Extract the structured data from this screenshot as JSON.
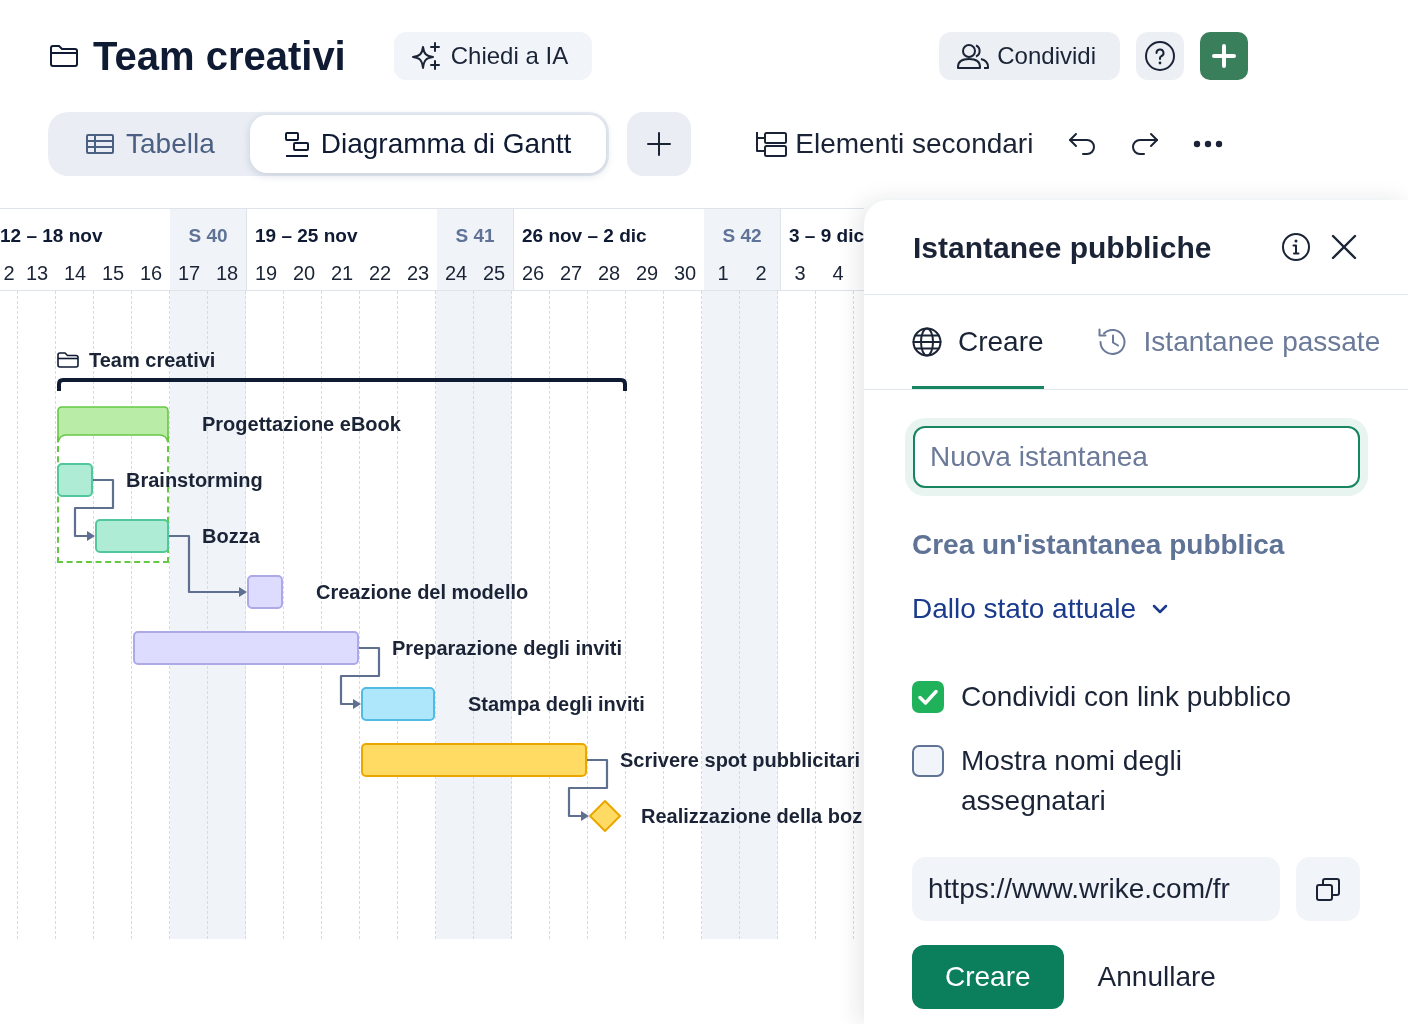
{
  "header": {
    "title": "Team creativi",
    "ai_button": "Chiedi a IA",
    "share_button": "Condividi"
  },
  "views": {
    "tabs": [
      {
        "label": "Tabella",
        "selected": false
      },
      {
        "label": "Diagramma di Gantt",
        "selected": true
      }
    ]
  },
  "toolbar": {
    "subitems_button": "Elementi secondari"
  },
  "timeline": {
    "weeks": [
      {
        "label": "12 – 18 nov",
        "days": [
          "2",
          "13",
          "14",
          "15",
          "16"
        ],
        "weekend_label": "S 40",
        "weekend_days": [
          "17",
          "18"
        ]
      },
      {
        "label": "19 – 25 nov",
        "days": [
          "19",
          "20",
          "21",
          "22",
          "23"
        ],
        "weekend_label": "S 41",
        "weekend_days": [
          "24",
          "25"
        ]
      },
      {
        "label": "26 nov – 2 dic",
        "days": [
          "26",
          "27",
          "28",
          "29",
          "30"
        ],
        "weekend_label": "S 42",
        "weekend_days": [
          "1",
          "2"
        ]
      },
      {
        "label": "3 – 9 dic",
        "days": [
          "3",
          "4"
        ]
      }
    ]
  },
  "gantt": {
    "group": {
      "name": "Team creativi",
      "children": [
        {
          "name": "Progettazione eBook",
          "kind": "project",
          "color": "#b9eca7",
          "linked": false,
          "expanded": true,
          "children": [
            {
              "name": "Brainstorming",
              "kind": "task",
              "color": "#aeecd5",
              "linked": false
            },
            {
              "name": "Bozza",
              "kind": "task",
              "color": "#aeecd5",
              "linked": true
            }
          ]
        },
        {
          "name": "Creazione del modello",
          "kind": "task",
          "color": "#dedcfe",
          "linked": true
        },
        {
          "name": "Preparazione degli inviti",
          "kind": "task",
          "color": "#dedcfe",
          "linked": false
        },
        {
          "name": "Stampa degli inviti",
          "kind": "task",
          "color": "#aee6fb",
          "linked": true
        },
        {
          "name": "Scrivere spot pubblicitari",
          "kind": "task",
          "color": "#ffdb63",
          "linked": false
        },
        {
          "name": "Realizzazione della boz",
          "kind": "milestone",
          "color": "#ffdb63",
          "linked": true
        }
      ]
    }
  },
  "snapshot_panel": {
    "title": "Istantanee pubbliche",
    "tabs": [
      {
        "label": "Creare",
        "selected": true
      },
      {
        "label": "Istantanee passate",
        "selected": false
      }
    ],
    "name_field": {
      "placeholder": "Nuova istantanea"
    },
    "section_title": "Crea un'istantanea pubblica",
    "source_dropdown": {
      "value": "Dallo stato attuale"
    },
    "options": [
      {
        "label": "Condividi con link pubblico",
        "checked": true
      },
      {
        "label": "Mostra nomi degli assegnatari",
        "checked": false
      }
    ],
    "link_field": {
      "value": "https://www.wrike.com/fr"
    },
    "buttons": [
      {
        "label": "Creare",
        "kind": "primary"
      },
      {
        "label": "Annullare",
        "kind": "secondary"
      }
    ]
  }
}
